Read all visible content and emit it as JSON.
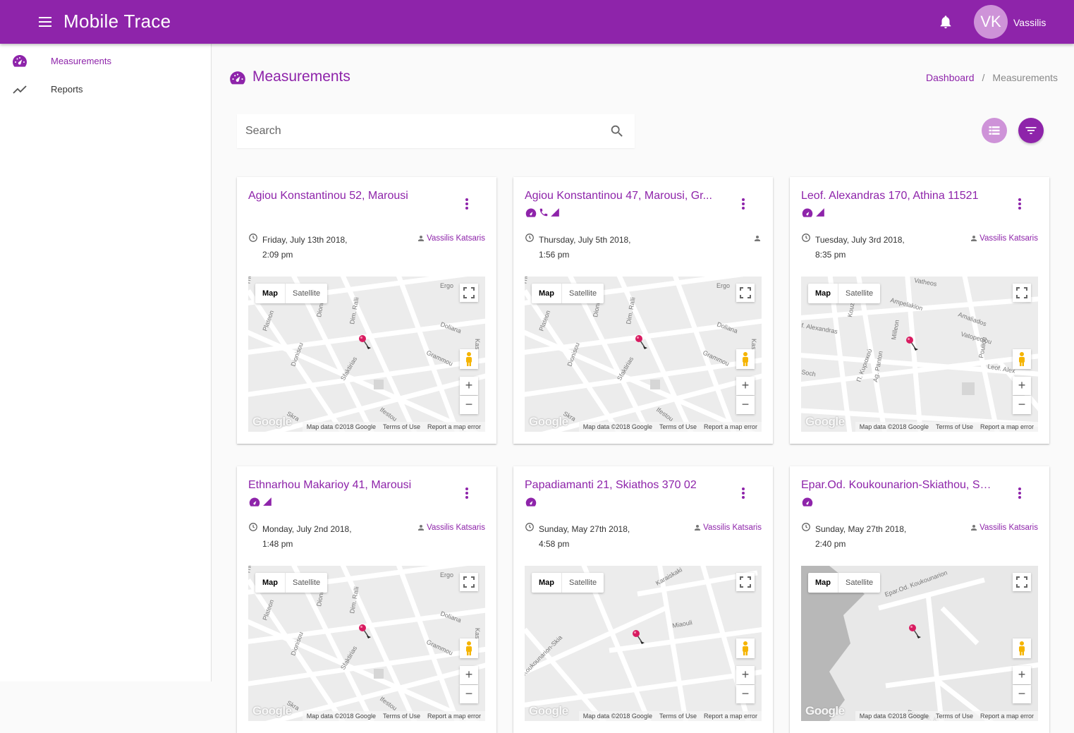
{
  "header": {
    "app_title": "Mobile Trace",
    "avatar_initials": "VK",
    "username": "Vassilis"
  },
  "sidebar": {
    "items": [
      {
        "label": "Measurements",
        "icon": "speedometer-icon",
        "active": true
      },
      {
        "label": "Reports",
        "icon": "trending-icon",
        "active": false
      }
    ]
  },
  "page": {
    "title": "Measurements",
    "breadcrumb": {
      "home": "Dashboard",
      "separator": "/",
      "current": "Measurements"
    }
  },
  "search": {
    "placeholder": "Search"
  },
  "colors": {
    "primary": "#8e24aa",
    "primary_light": "#ce93d8"
  },
  "cards": [
    {
      "title": "Agiou Konstantinou 52, Marousi",
      "badges": [],
      "date": "Friday, July 13th 2018,",
      "time": "2:09 pm",
      "user": "Vassilis Katsaris",
      "map": {
        "tab_map": "Map",
        "tab_satellite": "Satellite",
        "logo": "Google",
        "data": "Map data ©2018 Google",
        "terms": "Terms of Use",
        "report": "Report a map error",
        "streets": [
          "Themid",
          "Plateon",
          "Dionisou",
          "Dim. Ralli",
          "Ergo",
          "Doliana",
          "Grammou",
          "Dionisou",
          "Sfaktirias",
          "Skra",
          "Ifestou",
          "Kas"
        ]
      }
    },
    {
      "title": "Agiou Konstantinou 47, Marousi, Gr...",
      "badges": [
        "speedometer",
        "phone",
        "signal"
      ],
      "date": "Thursday, July 5th 2018,",
      "time": "1:56 pm",
      "user": "",
      "map": {
        "tab_map": "Map",
        "tab_satellite": "Satellite",
        "logo": "Google",
        "data": "Map data ©2018 Google",
        "terms": "Terms of Use",
        "report": "Report a map error",
        "streets": [
          "Themid",
          "Plateon",
          "Dionisou",
          "Dim. Ralli",
          "Ergo",
          "Doliana",
          "Grammou",
          "Dionisou",
          "Sfaktirias",
          "Skra",
          "Ifestou",
          "Kas"
        ]
      }
    },
    {
      "title": "Leof. Alexandras 170, Athina 11521",
      "badges": [
        "speedometer",
        "signal"
      ],
      "date": "Tuesday, July 3rd 2018,",
      "time": "8:35 pm",
      "user": "Vassilis Katsaris",
      "map": {
        "tab_map": "Map",
        "tab_satellite": "Satellite",
        "logo": "Google",
        "data": "Map data ©2018 Google",
        "terms": "Terms of Use",
        "report": "Report a map error",
        "streets": [
          "Vatheos",
          "Ampelakion",
          "Amaliados",
          "Vatopediou",
          "f. Alexandras",
          "Kouzi",
          "Milleon",
          "Leof. Alex",
          "Pouliou",
          "Soch",
          "Π. Κυριακού",
          "Ag. Panton"
        ]
      }
    },
    {
      "title": "Ethnarhou Makarioy 41, Marousi",
      "badges": [
        "speedometer",
        "signal"
      ],
      "date": "Monday, July 2nd 2018,",
      "time": "1:48 pm",
      "user": "Vassilis Katsaris",
      "map": {
        "tab_map": "Map",
        "tab_satellite": "Satellite",
        "logo": "Google",
        "data": "Map data ©2018 Google",
        "terms": "Terms of Use",
        "report": "Report a map error",
        "streets": [
          "Themid",
          "Plateon",
          "Dionisou",
          "Dim. Ralli",
          "Ergo",
          "Doliana",
          "Grammou",
          "Dionisou",
          "Sfaktirias",
          "Skra",
          "Ifestou",
          "Kas"
        ]
      }
    },
    {
      "title": "Papadiamanti 21, Skiathos 370 02",
      "badges": [
        "speedometer"
      ],
      "date": "Sunday, May 27th 2018,",
      "time": "4:58 pm",
      "user": "Vassilis Katsaris",
      "map": {
        "tab_map": "Map",
        "tab_satellite": "Satellite",
        "logo": "Google",
        "data": "Map data ©2018 Google",
        "terms": "Terms of Use",
        "report": "Report a map error",
        "streets": [
          "Koukounarion-Skia",
          "Karaiskaki",
          "Miaouli"
        ]
      }
    },
    {
      "title": "Epar.Od. Koukounarion-Skiathou, Skiathos",
      "badges": [
        "speedometer"
      ],
      "date": "Sunday, May 27th 2018,",
      "time": "2:40 pm",
      "user": "Vassilis Katsaris",
      "map": {
        "tab_map": "Map",
        "tab_satellite": "Satellite",
        "logo": "Google",
        "data": "Map data ©2018 Google",
        "terms": "Terms of Use",
        "report": "Report a map error",
        "streets": [
          "Epar.Od. Koukounarion",
          "Epar.Od. K"
        ]
      }
    }
  ]
}
